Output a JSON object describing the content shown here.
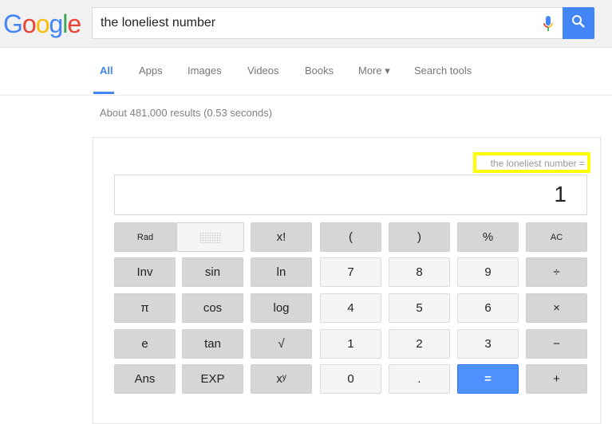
{
  "header": {
    "logo": "Google",
    "search_value": "the loneliest number",
    "colors": {
      "blue": "#4285f4",
      "red": "#ea4335",
      "yellow": "#fbbc05",
      "green": "#34a853"
    }
  },
  "tabs": [
    {
      "label": "All",
      "active": true
    },
    {
      "label": "Apps"
    },
    {
      "label": "Images"
    },
    {
      "label": "Videos"
    },
    {
      "label": "Books"
    },
    {
      "label": "More ▾"
    },
    {
      "label": "Search tools"
    }
  ],
  "stats": "About 481,000 results (0.53 seconds)",
  "calculator": {
    "expression": "the loneliest number =",
    "display": "1",
    "rows": [
      [
        "Rad",
        "",
        "x!",
        "(",
        ")",
        "%",
        "AC"
      ],
      [
        "Inv",
        "sin",
        "ln",
        "7",
        "8",
        "9",
        "÷"
      ],
      [
        "π",
        "cos",
        "log",
        "4",
        "5",
        "6",
        "×"
      ],
      [
        "e",
        "tan",
        "√",
        "1",
        "2",
        "3",
        "−"
      ],
      [
        "Ans",
        "EXP",
        "xʸ",
        "0",
        ".",
        "=",
        "+"
      ]
    ]
  }
}
